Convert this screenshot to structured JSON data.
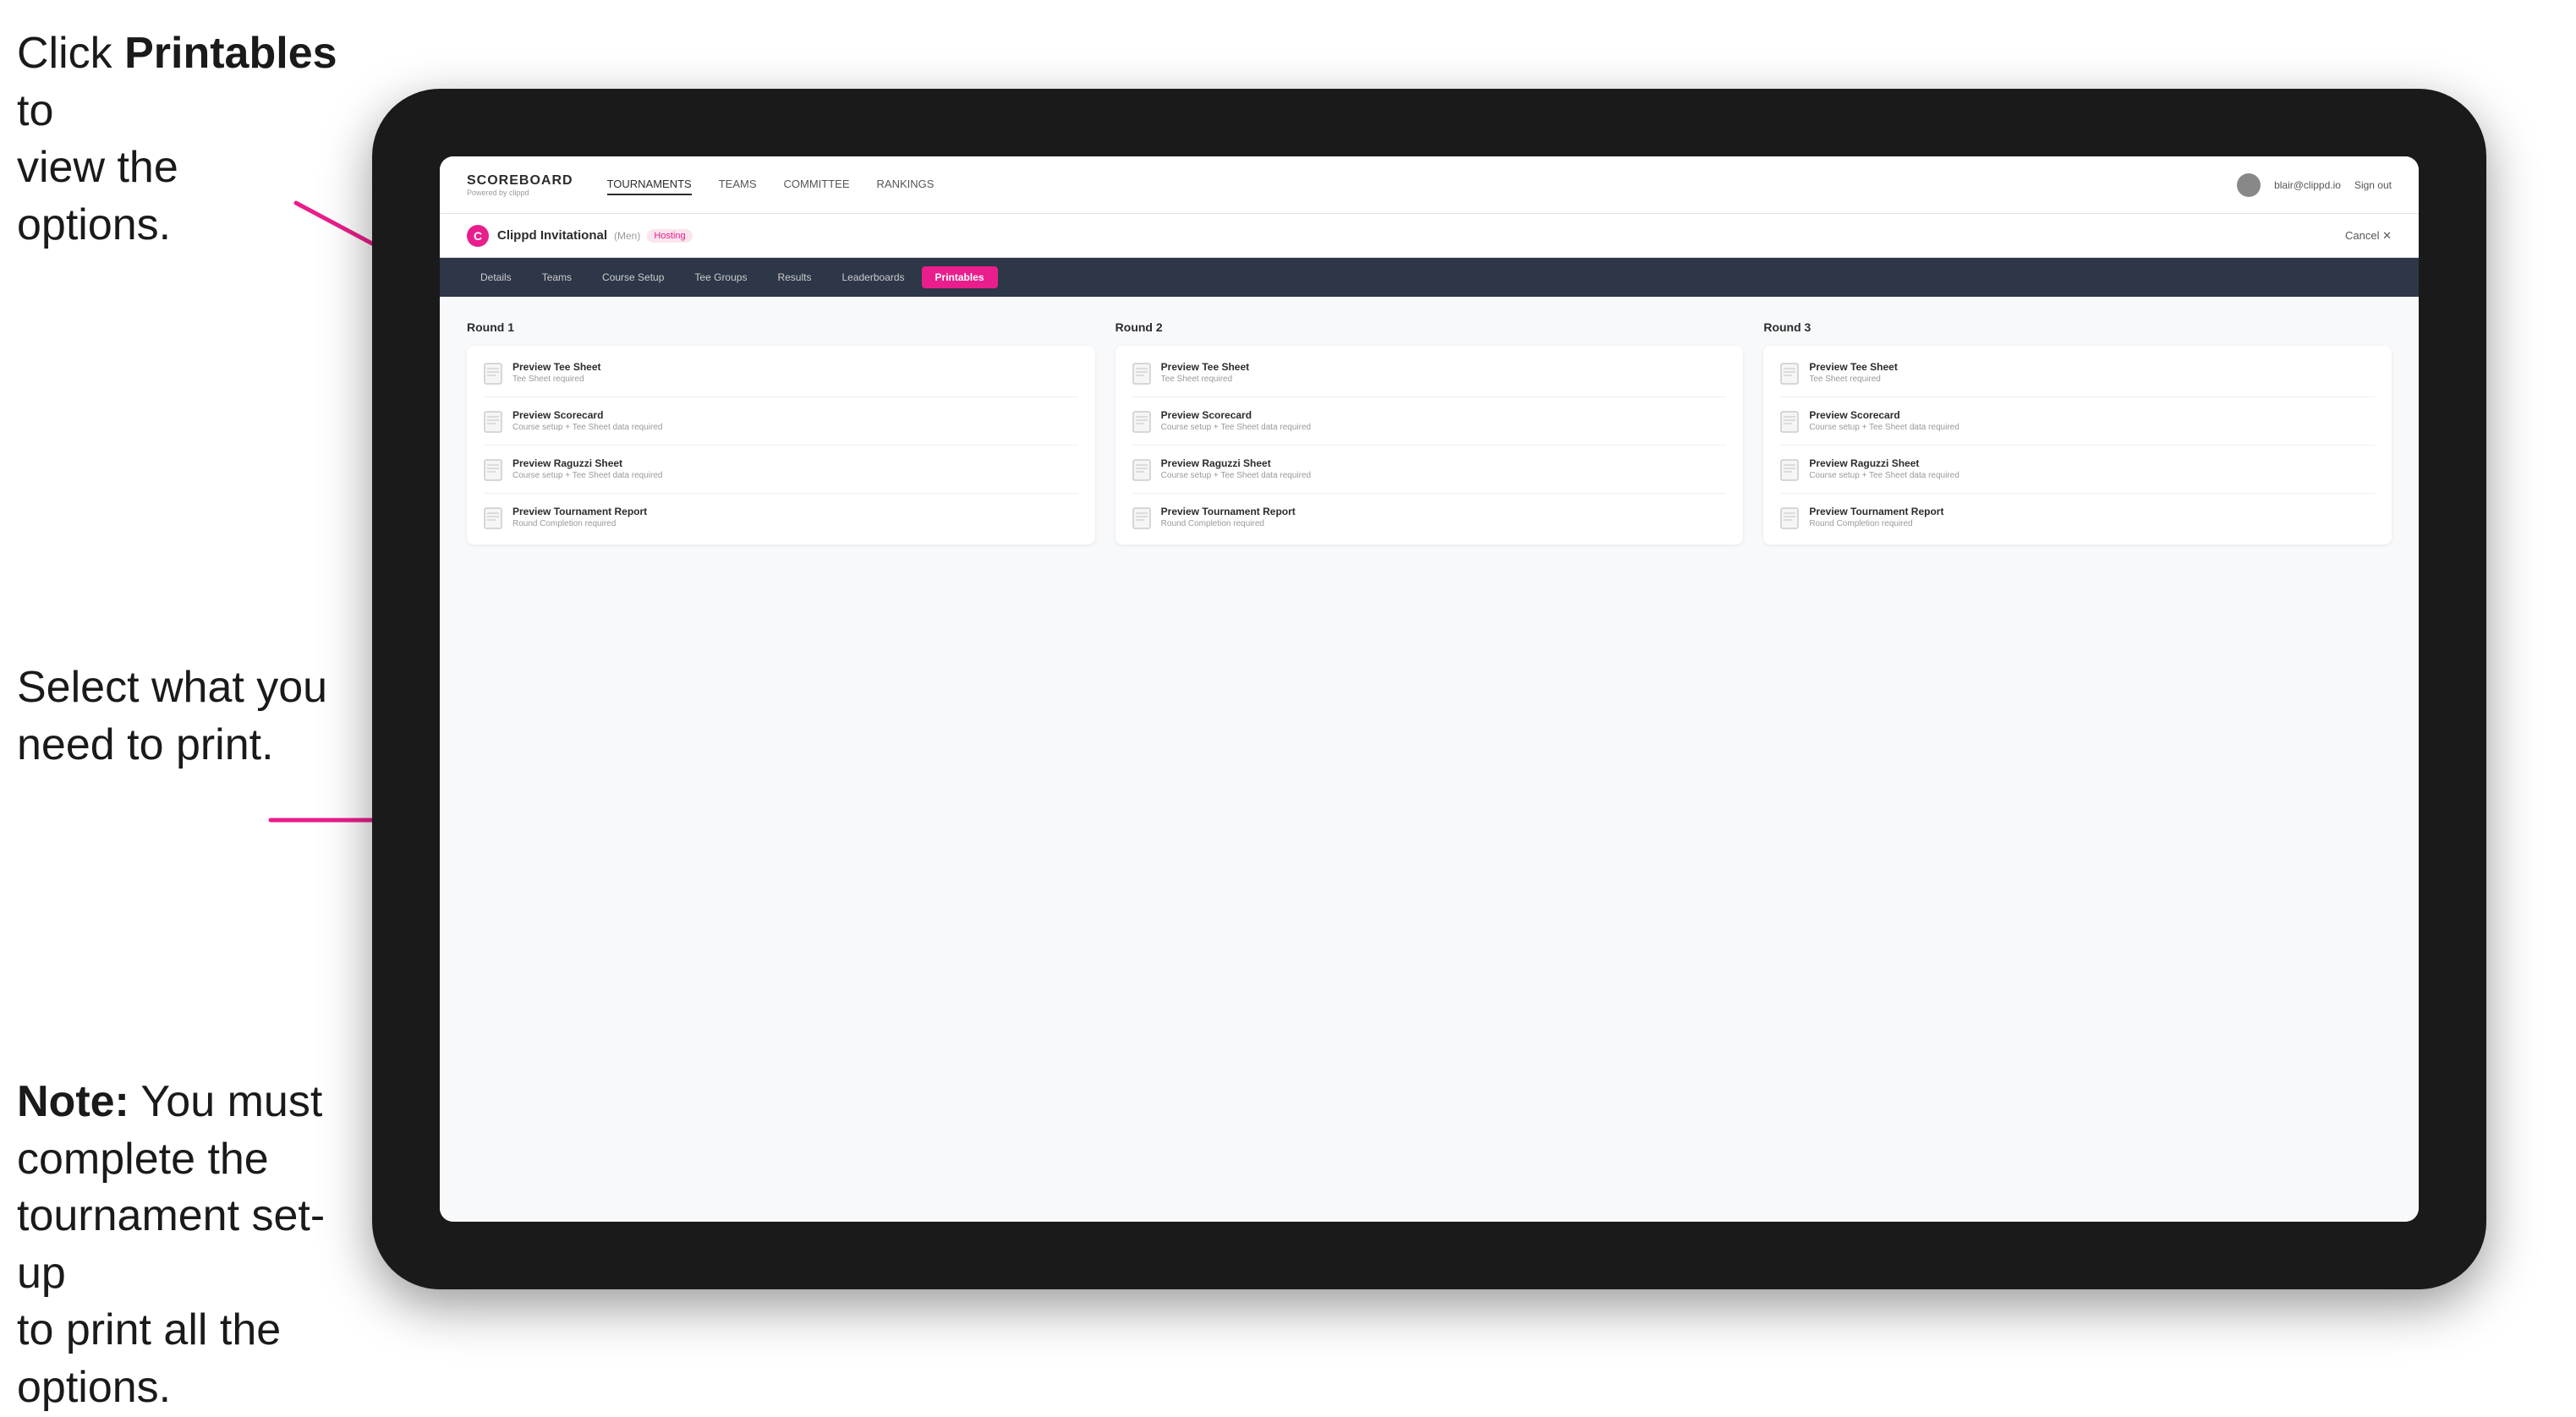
{
  "instructions": {
    "top_line1": "Click ",
    "top_bold": "Printables",
    "top_line2": " to",
    "top_line3": "view the options.",
    "middle": "Select what you\nneed to print.",
    "bottom_bold": "Note:",
    "bottom_rest": " You must\ncomplete the\ntournament set-up\nto print all the options."
  },
  "nav": {
    "logo": "SCOREBOARD",
    "logo_sub": "Powered by clippd",
    "links": [
      "TOURNAMENTS",
      "TEAMS",
      "COMMITTEE",
      "RANKINGS"
    ],
    "active_link": "TOURNAMENTS",
    "user_email": "blair@clippd.io",
    "sign_out": "Sign out"
  },
  "tournament": {
    "name": "Clippd Invitational",
    "gender": "(Men)",
    "status": "Hosting",
    "logo_letter": "C",
    "cancel": "Cancel  ✕"
  },
  "tabs": [
    {
      "label": "Details"
    },
    {
      "label": "Teams"
    },
    {
      "label": "Course Setup"
    },
    {
      "label": "Tee Groups"
    },
    {
      "label": "Results"
    },
    {
      "label": "Leaderboards"
    },
    {
      "label": "Printables",
      "active": true
    }
  ],
  "rounds": [
    {
      "title": "Round 1",
      "items": [
        {
          "label": "Preview Tee Sheet",
          "sublabel": "Tee Sheet required"
        },
        {
          "label": "Preview Scorecard",
          "sublabel": "Course setup + Tee Sheet data required"
        },
        {
          "label": "Preview Raguzzi Sheet",
          "sublabel": "Course setup + Tee Sheet data required"
        },
        {
          "label": "Preview Tournament Report",
          "sublabel": "Round Completion required"
        }
      ]
    },
    {
      "title": "Round 2",
      "items": [
        {
          "label": "Preview Tee Sheet",
          "sublabel": "Tee Sheet required"
        },
        {
          "label": "Preview Scorecard",
          "sublabel": "Course setup + Tee Sheet data required"
        },
        {
          "label": "Preview Raguzzi Sheet",
          "sublabel": "Course setup + Tee Sheet data required"
        },
        {
          "label": "Preview Tournament Report",
          "sublabel": "Round Completion required"
        }
      ]
    },
    {
      "title": "Round 3",
      "items": [
        {
          "label": "Preview Tee Sheet",
          "sublabel": "Tee Sheet required"
        },
        {
          "label": "Preview Scorecard",
          "sublabel": "Course setup + Tee Sheet data required"
        },
        {
          "label": "Preview Raguzzi Sheet",
          "sublabel": "Course setup + Tee Sheet data required"
        },
        {
          "label": "Preview Tournament Report",
          "sublabel": "Round Completion required"
        }
      ]
    }
  ],
  "colors": {
    "accent": "#e91e8c",
    "nav_bg": "#2d3748"
  }
}
